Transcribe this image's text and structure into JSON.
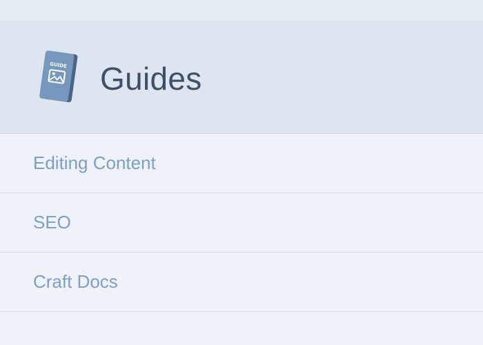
{
  "header": {
    "title": "Guides",
    "icon": "guide-book-icon",
    "icon_text": "GUIDE"
  },
  "links": [
    {
      "label": "Editing Content"
    },
    {
      "label": "SEO"
    },
    {
      "label": "Craft Docs"
    }
  ],
  "colors": {
    "header_bg": "#dde5f0",
    "page_bg": "#eff2f8",
    "link": "#7d9fc6",
    "title": "#3f5066"
  }
}
